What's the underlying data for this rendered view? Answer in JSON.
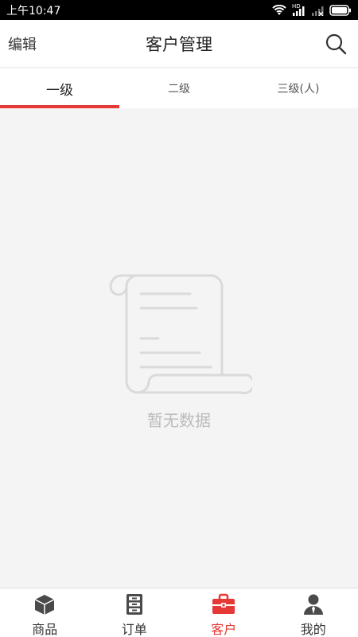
{
  "status_bar": {
    "time": "上午10:47",
    "hd_label": "HD"
  },
  "header": {
    "edit_label": "编辑",
    "title": "客户管理"
  },
  "tabs": [
    {
      "label": "一级",
      "active": true
    },
    {
      "label": "二级",
      "active": false
    },
    {
      "label": "三级(人)",
      "active": false
    }
  ],
  "empty_state": {
    "message": "暂无数据"
  },
  "bottom_nav": [
    {
      "label": "商品",
      "icon": "box-icon",
      "active": false
    },
    {
      "label": "订单",
      "icon": "cabinet-icon",
      "active": false
    },
    {
      "label": "客户",
      "icon": "briefcase-icon",
      "active": true
    },
    {
      "label": "我的",
      "icon": "person-icon",
      "active": false
    }
  ],
  "colors": {
    "accent": "#e53935",
    "background": "#f4f4f4",
    "empty_text": "#bbbbbb",
    "icon_dark": "#4a4a4a"
  }
}
